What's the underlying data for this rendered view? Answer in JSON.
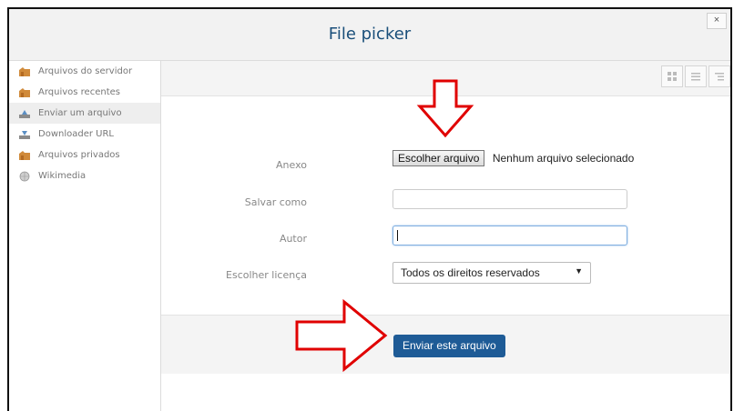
{
  "dialog": {
    "title": "File picker",
    "close_label": "×"
  },
  "sidebar": {
    "items": [
      {
        "label": "Arquivos do servidor",
        "icon": "folder-icon",
        "active": false
      },
      {
        "label": "Arquivos recentes",
        "icon": "folder-icon",
        "active": false
      },
      {
        "label": "Enviar um arquivo",
        "icon": "upload-icon",
        "active": true
      },
      {
        "label": "Downloader URL",
        "icon": "download-icon",
        "active": false
      },
      {
        "label": "Arquivos privados",
        "icon": "folder-icon",
        "active": false
      },
      {
        "label": "Wikimedia",
        "icon": "globe-icon",
        "active": false
      }
    ]
  },
  "toolbar": {
    "views": [
      "icons-view-icon",
      "list-view-icon",
      "tree-view-icon"
    ]
  },
  "form": {
    "attachment_label": "Anexo",
    "choose_file_button": "Escolher arquivo",
    "no_file_text": "Nenhum arquivo selecionado",
    "save_as_label": "Salvar como",
    "save_as_value": "",
    "author_label": "Autor",
    "author_value": "",
    "license_label": "Escolher licença",
    "license_value": "Todos os direitos reservados"
  },
  "footer": {
    "submit_label": "Enviar este arquivo"
  },
  "colors": {
    "title": "#1a4f7a",
    "submit_bg": "#1e5b96",
    "annotation_arrow": "#e00000"
  }
}
